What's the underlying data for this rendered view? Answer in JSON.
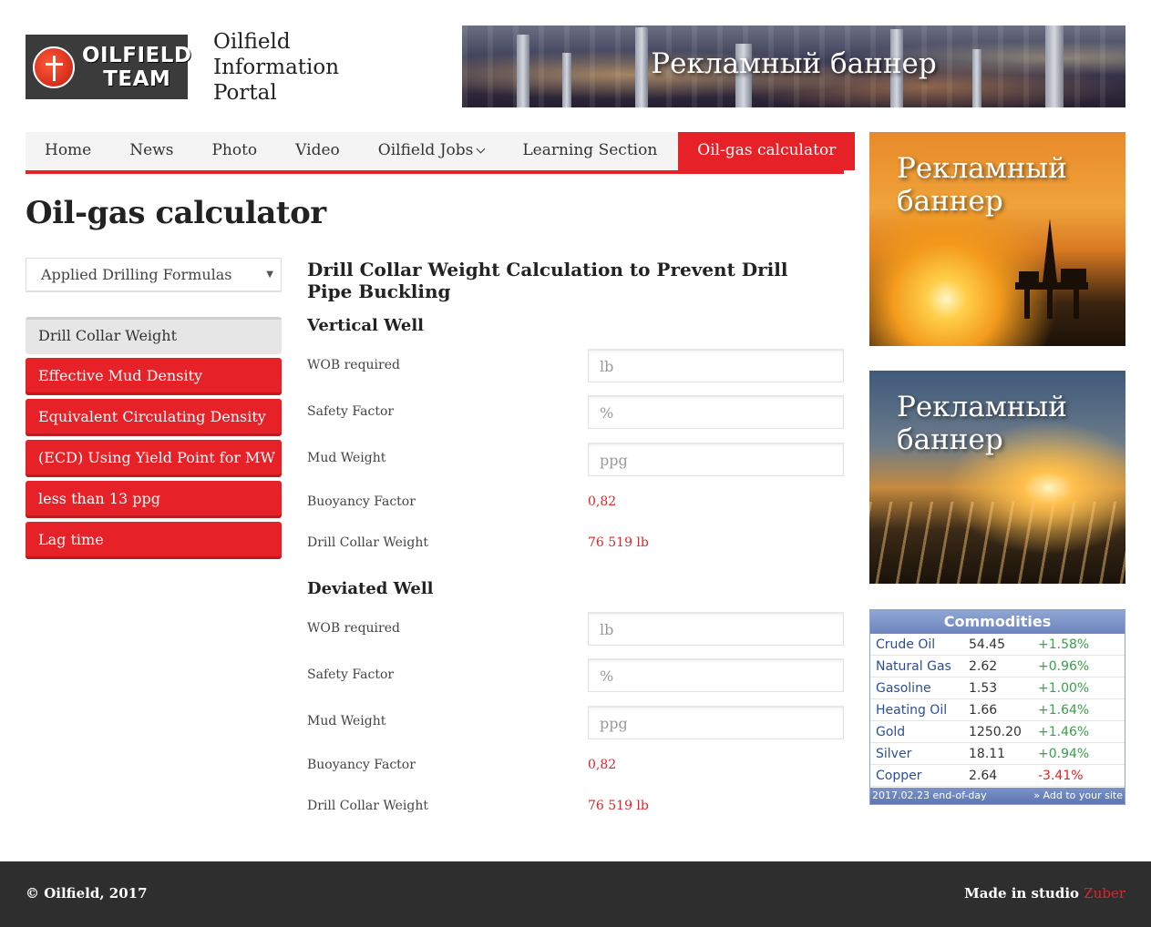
{
  "header": {
    "logo_line1": "OILFIELD",
    "logo_line2": "TEAM",
    "portal_line1": "Oilfield",
    "portal_line2": "Information",
    "portal_line3": "Portal",
    "banner_text": "Рекламный баннер"
  },
  "nav": {
    "items": [
      {
        "label": "Home"
      },
      {
        "label": "News"
      },
      {
        "label": "Photo"
      },
      {
        "label": "Video"
      },
      {
        "label": "Oilfield Jobs"
      },
      {
        "label": "Learning Section"
      },
      {
        "label": "Oil-gas calculator"
      }
    ]
  },
  "page": {
    "title": "Oil-gas calculator"
  },
  "sidebar": {
    "select_value": "Applied Drilling Formulas",
    "formulas": [
      {
        "label": "Drill Collar Weight"
      },
      {
        "label": "Effective Mud Density"
      },
      {
        "label": "Equivalent Circulating Density"
      },
      {
        "label": "(ECD) Using Yield Point for MW"
      },
      {
        "label": "less than 13 ppg"
      },
      {
        "label": "Lag time"
      }
    ]
  },
  "calculator": {
    "title": "Drill Collar Weight Calculation to Prevent Drill Pipe Buckling",
    "vertical": {
      "heading": "Vertical Well",
      "wob_label": "WOB required",
      "wob_placeholder": "lb",
      "safety_label": "Safety Factor",
      "safety_placeholder": "%",
      "mud_label": "Mud Weight",
      "mud_placeholder": "ppg",
      "buoyancy_label": "Buoyancy Factor",
      "buoyancy_value": "0,82",
      "dcw_label": "Drill Collar Weight",
      "dcw_value": "76 519 lb"
    },
    "deviated": {
      "heading": "Deviated Well",
      "wob_label": "WOB required",
      "wob_placeholder": "lb",
      "safety_label": "Safety Factor",
      "safety_placeholder": "%",
      "mud_label": "Mud Weight",
      "mud_placeholder": "ppg",
      "buoyancy_label": "Buoyancy Factor",
      "buoyancy_value": "0,82",
      "dcw_label": "Drill Collar Weight",
      "dcw_value": "76 519 lb"
    }
  },
  "ads": {
    "ad1_text": "Рекламный баннер",
    "ad2_text": "Рекламный баннер"
  },
  "commodities": {
    "title": "Commodities",
    "rows": [
      {
        "name": "Crude Oil",
        "price": "54.45",
        "change": "+1.58%"
      },
      {
        "name": "Natural Gas",
        "price": "2.62",
        "change": "+0.96%"
      },
      {
        "name": "Gasoline",
        "price": "1.53",
        "change": "+1.00%"
      },
      {
        "name": "Heating Oil",
        "price": "1.66",
        "change": "+1.64%"
      },
      {
        "name": "Gold",
        "price": "1250.20",
        "change": "+1.46%"
      },
      {
        "name": "Silver",
        "price": "18.11",
        "change": "+0.94%"
      },
      {
        "name": "Copper",
        "price": "2.64",
        "change": "-3.41%"
      }
    ],
    "footer_left": "2017.02.23 end-of-day",
    "footer_right": "» Add to your site"
  },
  "footer": {
    "copyright": "© Oilfield, 2017",
    "made_in": "Made in studio ",
    "studio": "Zuber"
  },
  "colors": {
    "accent": "#e62127",
    "footer_bg": "#2e2e2e",
    "nav_bg": "#f4f4f4"
  }
}
